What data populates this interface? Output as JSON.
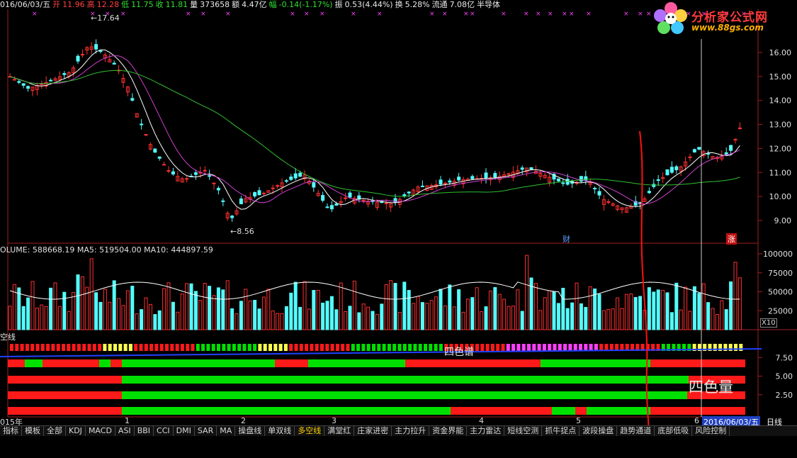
{
  "info": {
    "date": "016/06/03/五",
    "open_label": "开",
    "open": "11.96",
    "high_label": "高",
    "high": "12.28",
    "low_label": "低",
    "low": "11.75",
    "close_label": "收",
    "close": "11.81",
    "vol_label": "量",
    "vol": "373658",
    "amount_label": "额",
    "amount": "4.47亿",
    "change_label": "幅",
    "change": "-0.14(-1.17%)",
    "amp_label": "振",
    "amp": "0.53(4.44%)",
    "turnover_label": "换",
    "turnover": "5.28%",
    "float_label": "流通",
    "float": "7.08亿",
    "sector": "半导体"
  },
  "logo": {
    "title": "分析家公式网",
    "url": "www.88gs.com"
  },
  "price_panel": {
    "high_mark": "17.64",
    "low_mark": "8.56",
    "badge_cai": "财",
    "badge_zhang": "涨",
    "y_ticks": [
      "16.00",
      "15.00",
      "14.00",
      "13.00",
      "12.00",
      "11.00",
      "10.00",
      "9.00"
    ]
  },
  "volume_panel": {
    "title": "OLUME: 588668.19  MA5: 519504.00  MA10: 444897.59",
    "y_ticks": [
      "100000",
      "75000",
      "50000",
      "25000"
    ],
    "unit": "X10"
  },
  "indicator_panel": {
    "title": "空线",
    "label_four_color_spectrum": "四色谱",
    "label_four_color_volume": "四色量",
    "y_ticks": [
      "7.50",
      "5.00",
      "2.50"
    ]
  },
  "x_axis": {
    "labels": [
      "015年",
      "1",
      "2",
      "3",
      "4",
      "5",
      "6"
    ],
    "current_date": "2016/06/03/五",
    "period": "日线"
  },
  "tabs": [
    {
      "label": "指标",
      "active": false
    },
    {
      "label": "模板",
      "active": false
    },
    {
      "label": "全部",
      "active": false
    },
    {
      "label": "KDJ",
      "active": false
    },
    {
      "label": "MACD",
      "active": false
    },
    {
      "label": "ASI",
      "active": false
    },
    {
      "label": "BBI",
      "active": false
    },
    {
      "label": "CCI",
      "active": false
    },
    {
      "label": "DMI",
      "active": false
    },
    {
      "label": "SAR",
      "active": false
    },
    {
      "label": "MA",
      "active": false
    },
    {
      "label": "操盘线",
      "active": false
    },
    {
      "label": "单双线",
      "active": false
    },
    {
      "label": "多空线",
      "active": true
    },
    {
      "label": "满堂红",
      "active": false
    },
    {
      "label": "庄家进密",
      "active": false
    },
    {
      "label": "主力拉升",
      "active": false
    },
    {
      "label": "资金界能",
      "active": false
    },
    {
      "label": "主力雷达",
      "active": false
    },
    {
      "label": "短线空测",
      "active": false
    },
    {
      "label": "抓牛捉点",
      "active": false
    },
    {
      "label": "波段操盘",
      "active": false
    },
    {
      "label": "趋势通道",
      "active": false
    },
    {
      "label": "底部低吸",
      "active": false
    },
    {
      "label": "风险控制",
      "active": false
    }
  ],
  "colors": {
    "up": "#ff3030",
    "down": "#54fcfc",
    "ma5": "#ffffff",
    "ma10": "#d040d0",
    "ma60": "#30c030",
    "green": "#00e000",
    "red": "#ff1a1a",
    "yellow": "#ffff50",
    "magenta": "#ff40ff"
  }
}
